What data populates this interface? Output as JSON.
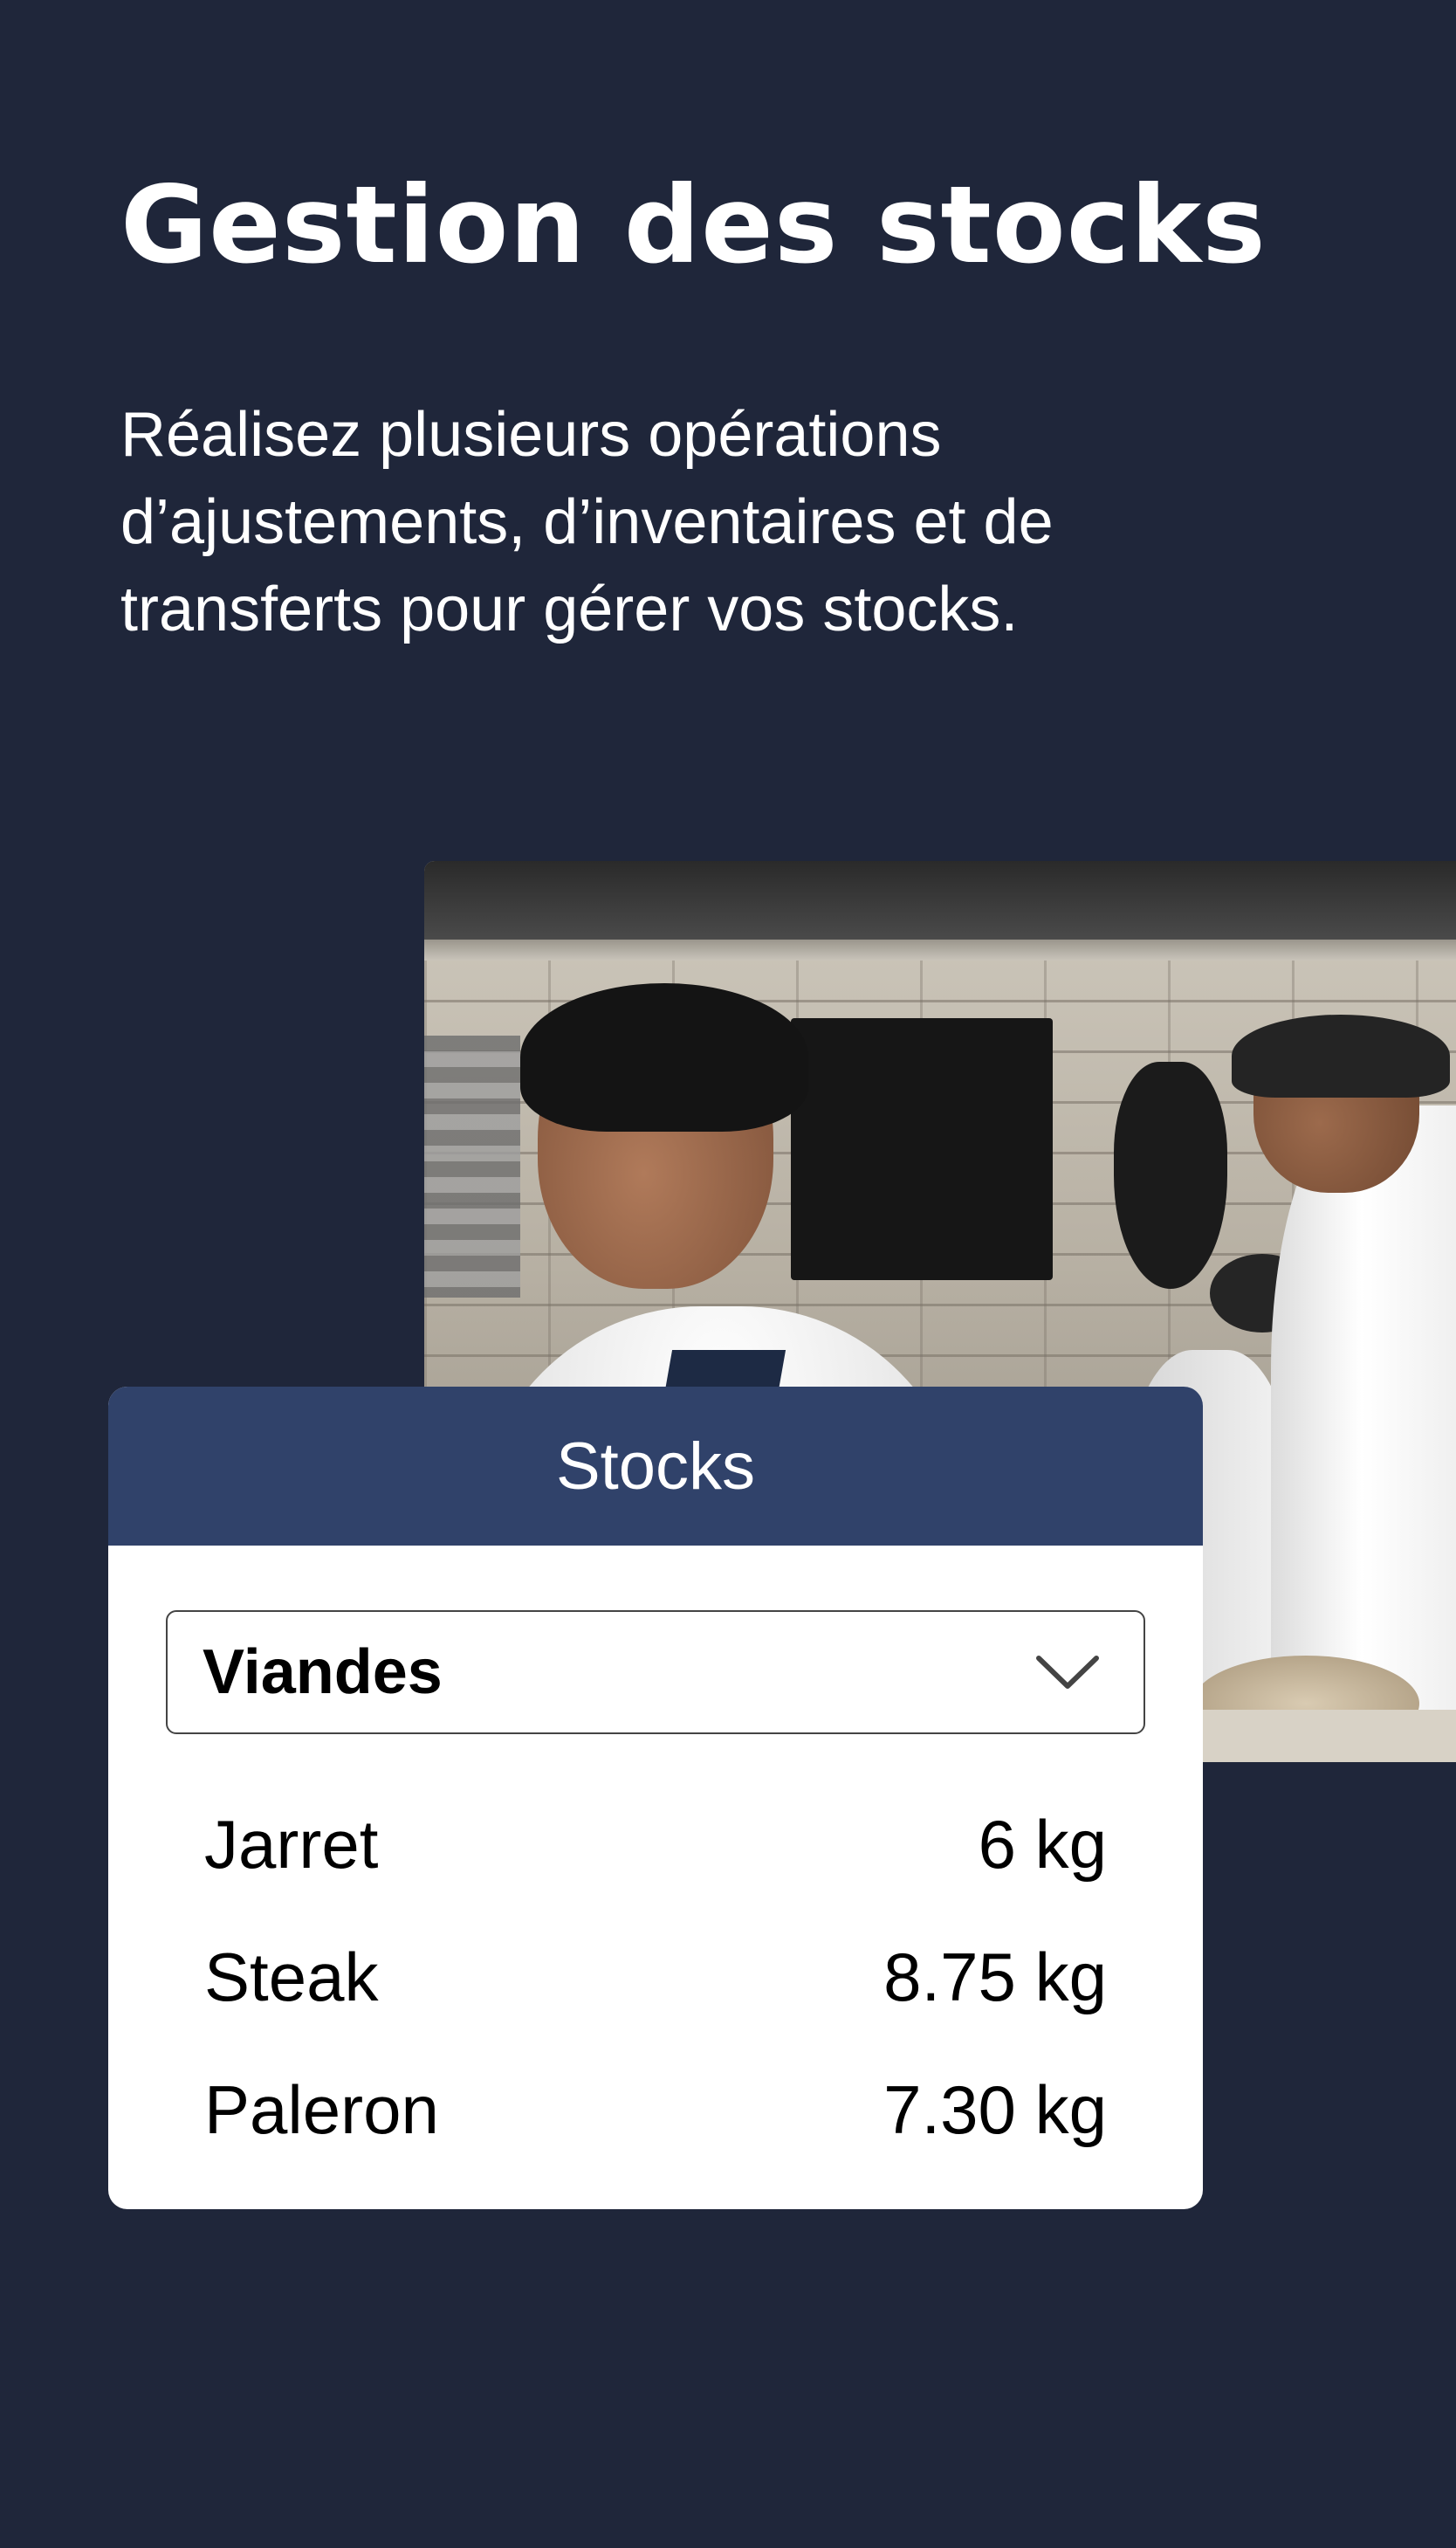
{
  "header": {
    "title": "Gestion des stocks",
    "subtitle": "Réalisez plusieurs opérations d’ajustements, d’inventaires et de transferts pour gérer vos stocks."
  },
  "photo": {
    "description_icon": "kitchen-chefs-photo"
  },
  "card": {
    "title": "Stocks",
    "category": {
      "selected": "Viandes",
      "icon": "chevron-down-icon"
    },
    "items": [
      {
        "name": "Jarret",
        "quantity": "6 kg"
      },
      {
        "name": "Steak",
        "quantity": "8.75 kg"
      },
      {
        "name": "Paleron",
        "quantity": "7.30 kg"
      }
    ]
  },
  "colors": {
    "background": "#1f263a",
    "card_header": "#30426a",
    "card": "#ffffff",
    "text_light": "#ffffff",
    "text_dark": "#000000"
  }
}
